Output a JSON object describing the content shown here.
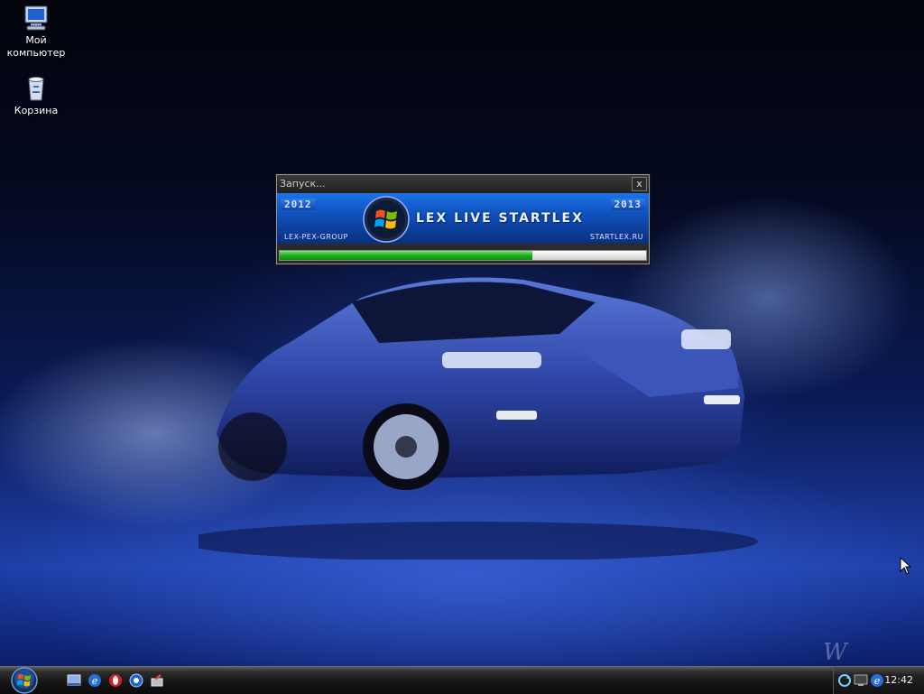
{
  "desktop": {
    "icons": [
      {
        "label": "Мой\nкомпьютер",
        "icon": "my-computer-icon"
      },
      {
        "label": "Корзина",
        "icon": "recycle-bin-icon"
      }
    ]
  },
  "splash": {
    "title": "Запуск...",
    "close_label": "x",
    "year_left": "2012",
    "year_right": "2013",
    "app_name": "LEX LIVE STARTLEX",
    "group": "LEX-PEX-GROUP",
    "site": "STARTLEX.RU",
    "progress_percent": 69,
    "colors": {
      "progress": "#20b020",
      "banner": "#1b73e6"
    }
  },
  "taskbar": {
    "quick_launch": [
      "show-desktop-icon",
      "ie-icon",
      "opera-icon",
      "media-player-icon",
      "tool-icon"
    ],
    "tray_icons": [
      "refresh-icon",
      "monitor-icon",
      "ie-tray-icon"
    ],
    "clock": "12:42"
  }
}
